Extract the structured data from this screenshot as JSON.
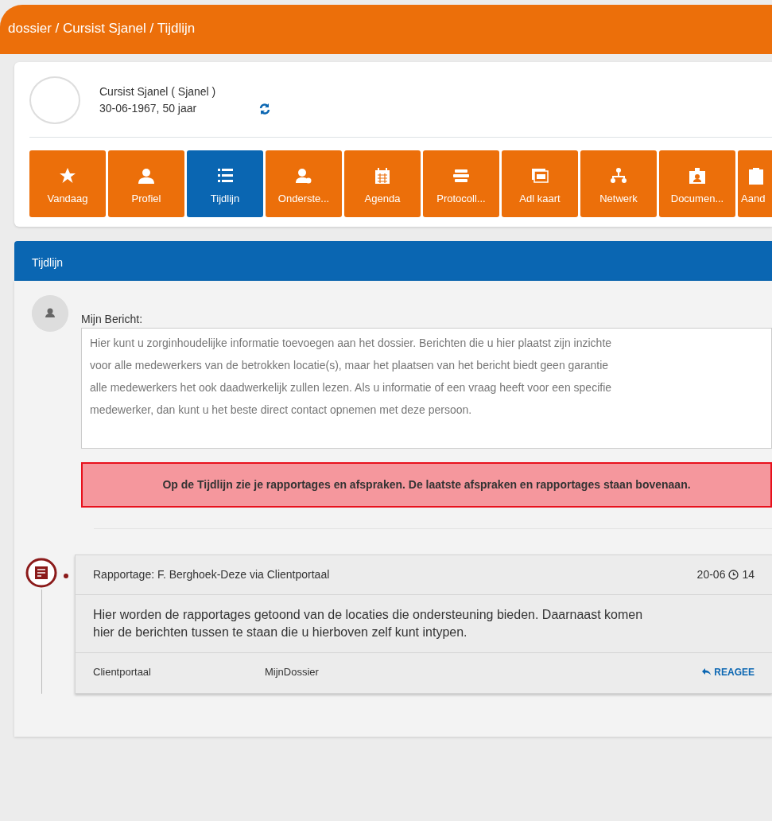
{
  "breadcrumb": "dossier / Cursist Sjanel / Tijdlijn",
  "client": {
    "name": "Cursist Sjanel ( Sjanel )",
    "birth": "30-06-1967, 50 jaar"
  },
  "tabs": [
    {
      "label": "Vandaag",
      "selected": false
    },
    {
      "label": "Profiel",
      "selected": false
    },
    {
      "label": "Tijdlijn",
      "selected": true
    },
    {
      "label": "Onderste...",
      "selected": false
    },
    {
      "label": "Agenda",
      "selected": false
    },
    {
      "label": "Protocoll...",
      "selected": false
    },
    {
      "label": "Adl kaart",
      "selected": false
    },
    {
      "label": "Netwerk",
      "selected": false
    },
    {
      "label": "Documen...",
      "selected": false
    },
    {
      "label": "Aand",
      "selected": false
    }
  ],
  "panel": {
    "title": "Tijdlijn"
  },
  "message": {
    "label": "Mijn Bericht:",
    "placeholder": "Hier kunt u zorginhoudelijke informatie toevoegen aan het dossier. Berichten die u hier plaatst zijn inzichte\nvoor alle medewerkers van de betrokken locatie(s), maar het plaatsen van het bericht biedt geen garantie\nalle medewerkers het ook daadwerkelijk zullen lezen. Als u informatie of een vraag heeft voor een specifie\nmedewerker, dan kunt u het beste direct contact opnemen met deze persoon."
  },
  "alert": "Op de Tijdlijn zie je rapportages en afspraken. De laatste afspraken en rapportages staan bovenaan.",
  "timeline": [
    {
      "title": "Rapportage: F. Berghoek-Deze via Clientportaal",
      "date": "20-06",
      "time": "14",
      "body": "Hier worden de rapportages getoond van de locaties die ondersteuning bieden. Daarnaast komen\nhier de berichten tussen te staan die u hierboven zelf kunt intypen.",
      "source": "Clientportaal",
      "channel": "MijnDossier",
      "action": "REAGEE"
    }
  ]
}
